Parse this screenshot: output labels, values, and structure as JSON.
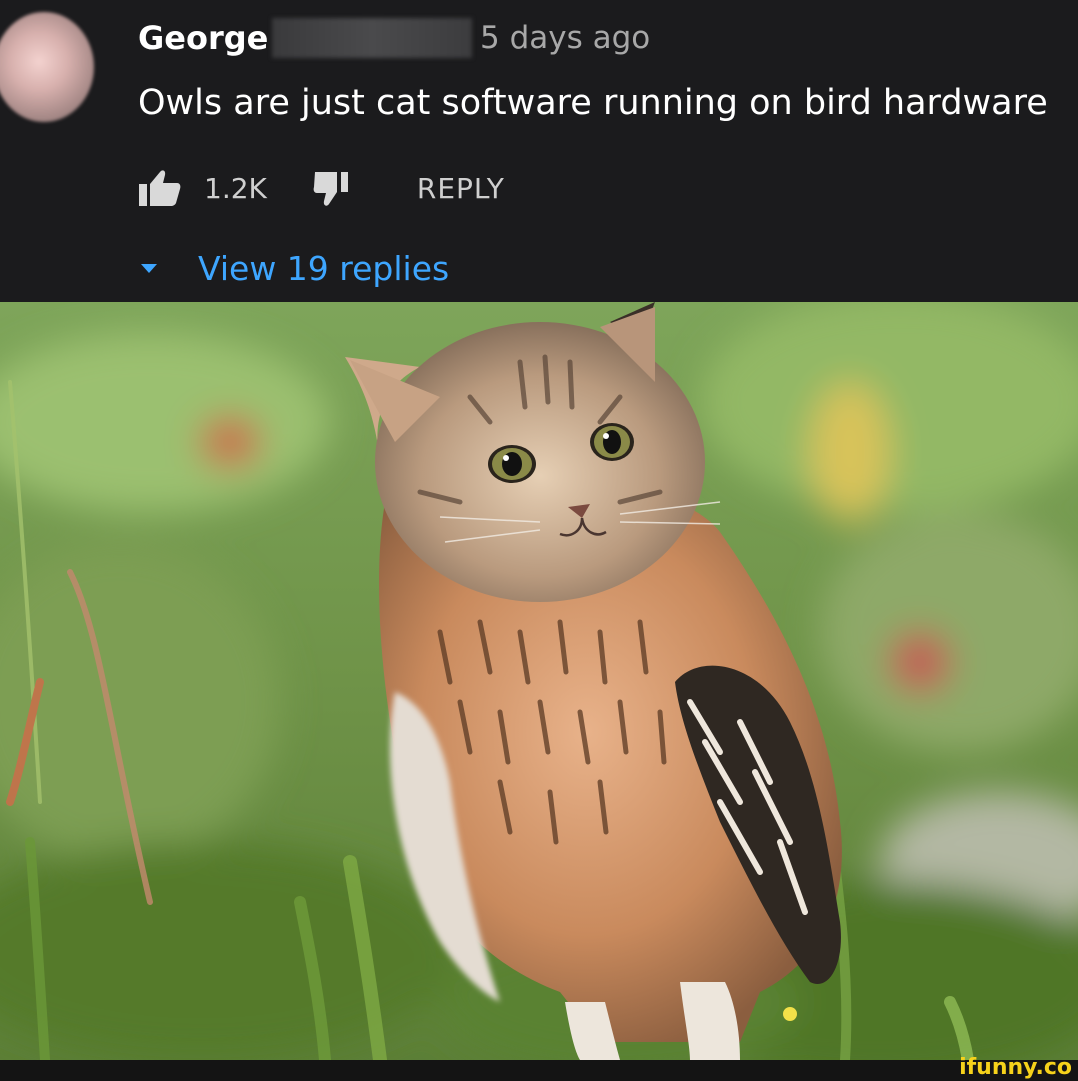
{
  "comment": {
    "author": "George",
    "timestamp": "5 days ago",
    "text": "Owls are just cat software running on bird hardware",
    "like_count": "1.2K",
    "reply_label": "REPLY",
    "view_replies_label": "View 19 replies",
    "icons": {
      "like": "thumbs-up-icon",
      "dislike": "thumbs-down-icon",
      "expand": "caret-down-icon"
    }
  },
  "watermark": "ifunny.co",
  "colors": {
    "background": "#1b1b1d",
    "link": "#3ea6ff",
    "watermark": "#f6d21b"
  }
}
